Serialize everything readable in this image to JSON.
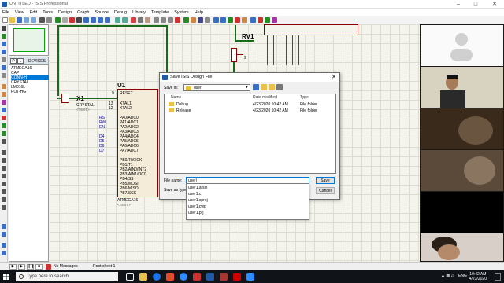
{
  "window": {
    "title": "UNTITLED - ISIS Professional"
  },
  "menu": [
    "File",
    "View",
    "Edit",
    "Tools",
    "Design",
    "Graph",
    "Source",
    "Debug",
    "Library",
    "Template",
    "System",
    "Help"
  ],
  "devices": {
    "p_label": "P",
    "l_label": "L",
    "header": "DEVICES",
    "items": [
      "ATMEGA16",
      "CAP",
      "CONN-H",
      "CRYSTAL",
      "LM016L",
      "POT-HG"
    ]
  },
  "schematic": {
    "u1_ref": "U1",
    "x1_ref": "X1",
    "x1_value": "CRYSTAL",
    "x1_text": "<TEXT>",
    "rv1_ref": "RV1",
    "u1_part": "ATMEGA16",
    "u1_text": "<TEXT>",
    "pins_left": [
      "RESET",
      "XTAL1",
      "XTAL2"
    ],
    "pin_nums_left": [
      "9",
      "13",
      "12"
    ],
    "pins_pa": [
      "PA0/ADC0",
      "PA1/ADC1",
      "PA2/ADC2",
      "PA3/ADC3",
      "PA4/ADC4",
      "PA5/ADC5",
      "PA6/ADC6",
      "PA7/ADC7"
    ],
    "pins_pb": [
      "PB0/T0/XCK",
      "PB1/T1",
      "PB2/AIN0/INT2",
      "PB3/AIN1/OC0",
      "PB4/SS",
      "PB5/MOSI",
      "PB6/MISO",
      "PB7/SCK"
    ],
    "net_labels": [
      "RS",
      "RW",
      "EN",
      "D4",
      "D5",
      "D6",
      "D7"
    ],
    "rv_pin": "2"
  },
  "status": {
    "messages": "No Messages",
    "sheet": "Root sheet 1"
  },
  "dialog": {
    "title": "Save ISIS Design File",
    "save_in_label": "Save in:",
    "save_in_value": "user",
    "columns": [
      "Name",
      "Date modified",
      "Type"
    ],
    "files": [
      {
        "name": "Debug",
        "date": "4/23/2020 10:42 AM",
        "type": "File folder"
      },
      {
        "name": "Release",
        "date": "4/23/2020 10:42 AM",
        "type": "File folder"
      }
    ],
    "file_name_label": "File name:",
    "file_name_value": "user|",
    "save_type_label": "Save as type:",
    "suggestions": [
      "user1.atsln",
      "user1.c",
      "user1.cproj",
      "user1.cwp",
      "user1.prj"
    ],
    "save_button": "Save",
    "cancel_button": "Cancel"
  },
  "taskbar": {
    "search_placeholder": "Type here to search",
    "tray_lang": "ENG",
    "time": "10:42 AM",
    "date": "4/23/2020"
  },
  "colors": {
    "wire": "#1a6a1a",
    "component": "#8b0000",
    "accent": "#0078d7"
  }
}
